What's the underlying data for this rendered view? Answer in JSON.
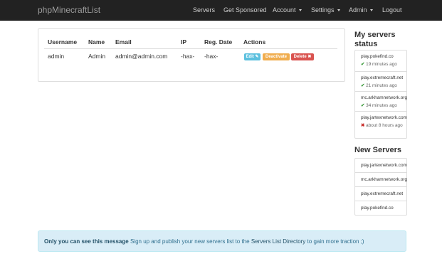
{
  "navbar": {
    "brand": "phpMinecraftList",
    "items": [
      {
        "label": "Servers"
      },
      {
        "label": "Get Sponsored"
      },
      {
        "label": "Account"
      },
      {
        "label": "Settings"
      },
      {
        "label": "Admin"
      },
      {
        "label": "Logout"
      }
    ]
  },
  "users_table": {
    "headers": [
      "Username",
      "Name",
      "Email",
      "IP",
      "Reg. Date",
      "Actions"
    ],
    "rows": [
      {
        "username": "admin",
        "name": "Admin",
        "email": "admin@admin.com",
        "ip": "-hax-",
        "reg_date": "-hax-",
        "actions": {
          "edit": "Edit",
          "deactivate": "Deactivate",
          "delete": "Delete"
        }
      }
    ]
  },
  "colors": {
    "edit": "#5bc0de",
    "deactivate": "#f0ad4e",
    "delete": "#d9534f",
    "navbar": "#222222"
  },
  "servers_status": {
    "title": "My servers status",
    "items": [
      {
        "server": "play.pokefind.co",
        "status": "up",
        "time": "19 minutes ago"
      },
      {
        "server": "play.extremecraft.net",
        "status": "up",
        "time": "21 minutes ago"
      },
      {
        "server": "mc.arkhamnetwork.org",
        "status": "up",
        "time": "34 minutes ago"
      },
      {
        "server": "play.jartexnetwork.com",
        "status": "down",
        "time": "about 8 hours ago"
      }
    ]
  },
  "new_servers": {
    "title": "New Servers",
    "items": [
      "play.jartexnetwork.com",
      "mc.arkhamnetwork.org",
      "play.extremecraft.net",
      "play.pokefind.co"
    ]
  },
  "alert": {
    "strong": "Only you can see this message",
    "text1": "Sign up and publish your new servers list to the",
    "link": "Servers List Directory",
    "text2": "to gain more traction ;)"
  }
}
